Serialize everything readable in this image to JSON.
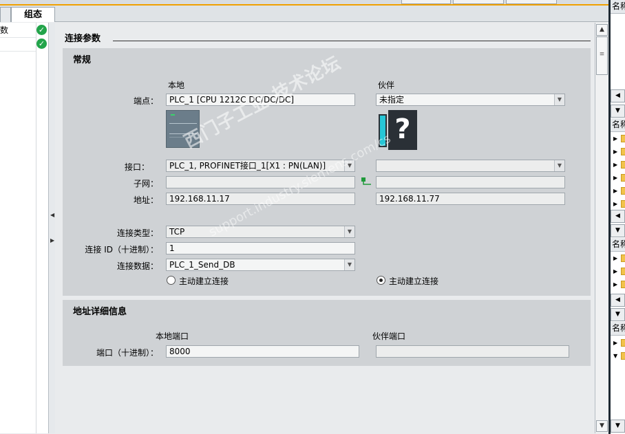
{
  "tabs": {
    "config": "组态"
  },
  "left_tree": {
    "items": [
      {
        "label": "数"
      },
      {
        "label": ""
      }
    ]
  },
  "section": {
    "title": "连接参数"
  },
  "general": {
    "title": "常规",
    "local_header": "本地",
    "partner_header": "伙伴",
    "endpoint_label": "端点：",
    "endpoint_local": "PLC_1 [CPU 1212C DC/DC/DC]",
    "endpoint_partner": "未指定",
    "interface_label": "接口：",
    "interface_local": "PLC_1, PROFINET接口_1[X1 : PN(LAN)]",
    "interface_partner": "",
    "subnet_label": "子网：",
    "subnet_local": "",
    "subnet_partner": "",
    "address_label": "地址：",
    "address_local": "192.168.11.17",
    "address_partner": "192.168.11.77",
    "conn_type_label": "连接类型：",
    "conn_type_value": "TCP",
    "conn_id_label": "连接 ID（十进制）：",
    "conn_id_value": "1",
    "conn_data_label": "连接数据：",
    "conn_data_value": "PLC_1_Send_DB",
    "active_local_label": "主动建立连接",
    "active_local_selected": false,
    "active_partner_label": "主动建立连接",
    "active_partner_selected": true
  },
  "address_details": {
    "title": "地址详细信息",
    "local_port_header": "本地端口",
    "partner_port_header": "伙伴端口",
    "port_label": "端口（十进制）：",
    "local_port_value": "8000",
    "partner_port_value": ""
  },
  "right_panel": {
    "headers": [
      "名称",
      "名称",
      "名称",
      "名称"
    ]
  },
  "watermark": {
    "line1": "西门子工业  技术论坛",
    "line2": "support.industry.siemens.com/cs"
  },
  "icons": [
    "check-icon",
    "dropdown-arrow-icon",
    "radio-icon",
    "network-icon",
    "unknown-device-icon",
    "scroll-up-icon",
    "scroll-down-icon",
    "folder-icon"
  ]
}
